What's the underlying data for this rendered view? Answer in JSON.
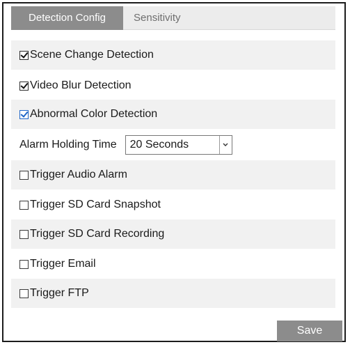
{
  "tabs": {
    "detection_config": "Detection Config",
    "sensitivity": "Sensitivity"
  },
  "options": {
    "scene_change": {
      "label": "Scene Change Detection",
      "checked": true
    },
    "video_blur": {
      "label": "Video Blur Detection",
      "checked": true
    },
    "abnormal_color": {
      "label": "Abnormal Color Detection",
      "checked": true
    },
    "trigger_audio": {
      "label": "Trigger Audio Alarm",
      "checked": false
    },
    "trigger_sd_snapshot": {
      "label": "Trigger SD Card Snapshot",
      "checked": false
    },
    "trigger_sd_recording": {
      "label": "Trigger SD Card Recording",
      "checked": false
    },
    "trigger_email": {
      "label": "Trigger Email",
      "checked": false
    },
    "trigger_ftp": {
      "label": "Trigger FTP",
      "checked": false
    }
  },
  "alarm_holding": {
    "label": "Alarm Holding Time",
    "value": "20 Seconds"
  },
  "buttons": {
    "save": "Save"
  },
  "colors": {
    "tab_active_bg": "#8c8c8c",
    "row_shade": "#f1f1f1",
    "checkbox_focus": "#1e66c8"
  }
}
